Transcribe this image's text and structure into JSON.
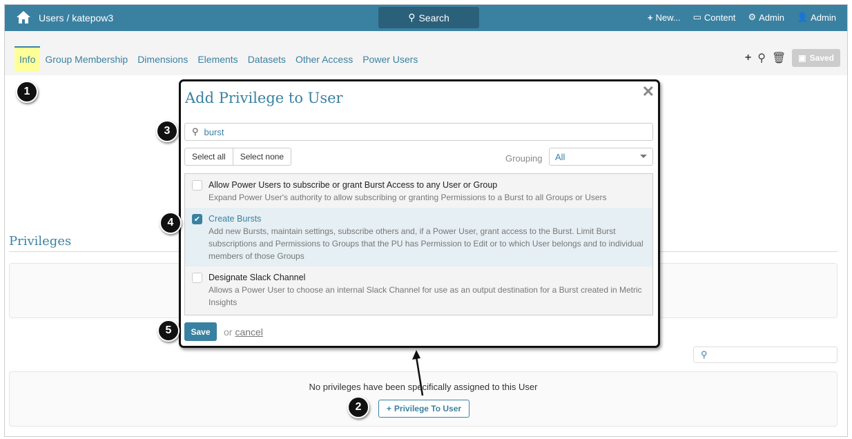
{
  "header": {
    "breadcrumb": "Users / katepow3",
    "search": "Search",
    "new": "New...",
    "content": "Content",
    "admin_settings": "Admin",
    "user": "Admin"
  },
  "tabs": [
    "Info",
    "Group Membership",
    "Dimensions",
    "Elements",
    "Datasets",
    "Other Access",
    "Power Users"
  ],
  "toolbar": {
    "saved": "Saved"
  },
  "privileges": {
    "heading": "Privileges",
    "empty_text": "No privileges have been specifically assigned to this User",
    "add_button": "Privilege To User"
  },
  "modal": {
    "title": "Add Privilege to User",
    "search_value": "burst",
    "select_all": "Select all",
    "select_none": "Select none",
    "grouping_label": "Grouping",
    "grouping_value": "All",
    "items": [
      {
        "title": "Allow Power Users to subscribe or grant Burst Access to any User or Group",
        "desc": "Expand Power User's authority to allow subscribing or granting Permissions to a Burst to all Groups or Users",
        "checked": false
      },
      {
        "title": "Create Bursts",
        "desc": "Add new Bursts, maintain settings, subscribe others and, if a Power User, grant access to the Burst. Limit Burst subscriptions and Permissions to Groups that the PU has Permission to Edit or to which User belongs and to individual members of those Groups",
        "checked": true
      },
      {
        "title": "Designate Slack Channel",
        "desc": "Allows a Power User to choose an internal Slack Channel for use as an output destination for a Burst created in Metric Insights",
        "checked": false
      }
    ],
    "save": "Save",
    "or": "or",
    "cancel": "cancel"
  },
  "badges": [
    "1",
    "2",
    "3",
    "4",
    "5"
  ],
  "colors": {
    "brand": "#3a81a1"
  }
}
